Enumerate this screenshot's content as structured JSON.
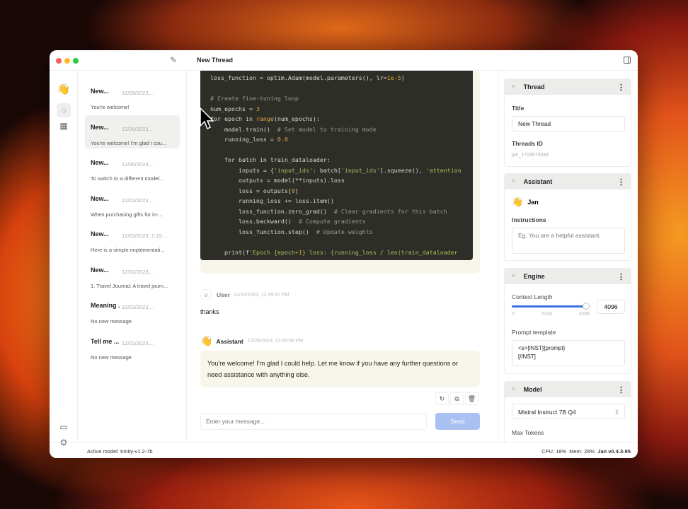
{
  "window": {
    "title": "New Thread"
  },
  "rail": {
    "logo": "👋",
    "icons": [
      "chat-icon",
      "grid-icon",
      "monitor-icon",
      "gear-icon"
    ]
  },
  "threads": [
    {
      "name": "New...",
      "date": "12/28/2023,...",
      "preview": "You're welcome!",
      "selected": false
    },
    {
      "name": "New...",
      "date": "12/26/2023,...",
      "preview": "You're welcome! I'm glad I cou...",
      "selected": true
    },
    {
      "name": "New...",
      "date": "12/26/2023,...",
      "preview": "To switch to a different model...",
      "selected": false
    },
    {
      "name": "New...",
      "date": "12/22/2023,...",
      "preview": "When purchasing gifts for in-...",
      "selected": false
    },
    {
      "name": "New...",
      "date": "12/22/2023, 1:15:...",
      "preview": "Here is a simple implementati...",
      "selected": false
    },
    {
      "name": "New...",
      "date": "12/22/2023,...",
      "preview": "1. Travel Journal: A travel journ...",
      "selected": false
    },
    {
      "name": "Meaning ...",
      "date": "12/22/2023,...",
      "preview": "No new message",
      "selected": false
    },
    {
      "name": "Tell me ...",
      "date": "12/22/2023,...",
      "preview": "No new message",
      "selected": false
    }
  ],
  "code_lines": [
    "loss_function = optim.Adam(model.parameters(), lr=1e-5)",
    "",
    "# Create fine-tuning loop",
    "num_epochs = 3",
    "for epoch in range(num_epochs):",
    "    model.train()  # Set model to training mode",
    "    running_loss = 0.0",
    "",
    "    for batch in train_dataloader:",
    "        inputs = {'input_ids': batch['input_ids'].squeeze(), 'attention",
    "        outputs = model(**inputs).loss",
    "        loss = outputs[0]",
    "        running_loss += loss.item()",
    "        loss_function.zero_grad()  # Clear gradients for this batch",
    "        loss.backward()  # Compute gradients",
    "        loss_function.step()  # Update weights",
    "",
    "    print(f'Epoch {epoch+1} loss: {running_loss / len(train_dataloader"
  ],
  "messages": {
    "user": {
      "name": "User",
      "time": "12/26/2023, 12:35:47 PM",
      "text": "thanks"
    },
    "assistant": {
      "avatar": "👋",
      "name": "Assistant",
      "time": "12/26/2023, 12:35:56 PM",
      "text": "You're welcome! I'm glad I could help. Let me know if you have any further questions or need assistance with anything else."
    }
  },
  "composer": {
    "placeholder": "Enter your message...",
    "send": "Send"
  },
  "settings": {
    "thread": {
      "header": "Thread",
      "title_label": "Title",
      "title_value": "New Thread",
      "id_label": "Threads ID",
      "id_value": "jan_1703574534"
    },
    "assistant": {
      "header": "Assistant",
      "avatar": "👋",
      "name": "Jan",
      "instructions_label": "Instructions",
      "instructions_placeholder": "Eg. You are a helpful assistant."
    },
    "engine": {
      "header": "Engine",
      "context_label": "Context Length",
      "min": "0",
      "mid": "2048",
      "max": "4096",
      "value": "4096",
      "fraction": 1.0,
      "prompt_label": "Prompt template",
      "prompt_value": "<s>[INST]{prompt}\n[/INST]"
    },
    "model": {
      "header": "Model",
      "selected": "Mistral Instruct 7B Q4",
      "max_tokens_label": "Max Tokens"
    }
  },
  "status": {
    "active_model": "Active model: trinity-v1.2-7b",
    "cpu": "CPU: 18%",
    "mem": "Mem: 28%",
    "version": "Jan v0.4.3-95"
  },
  "colors": {
    "accent": "#3b6fe0",
    "send_disabled": "#a9c1f2"
  }
}
